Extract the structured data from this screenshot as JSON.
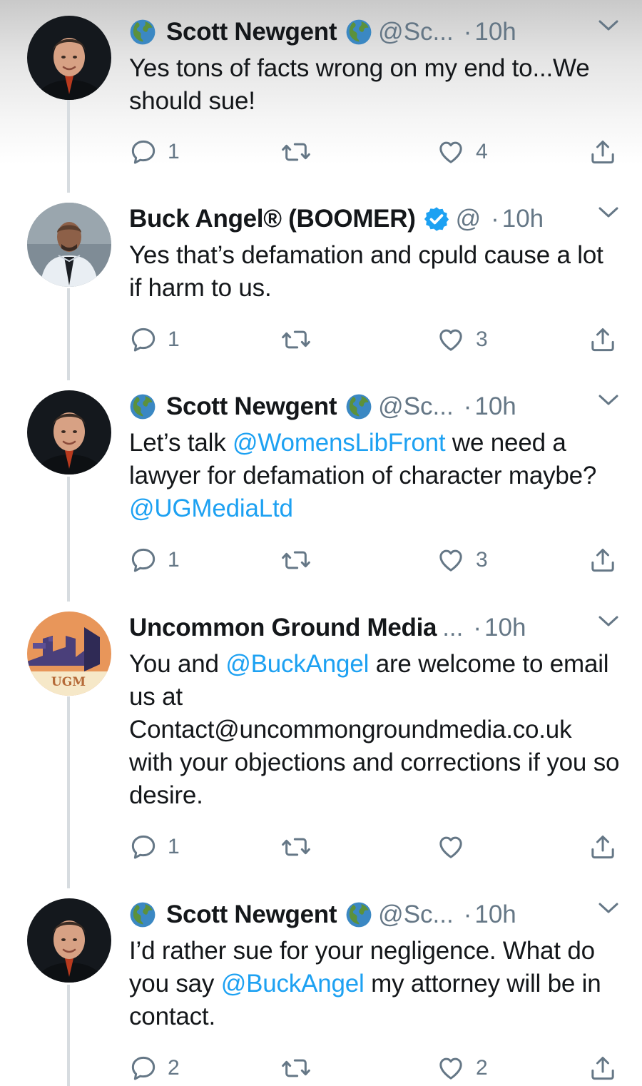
{
  "theme": {
    "mention_color": "#1da1f2",
    "verified_color": "#1da1f2",
    "muted_color": "#657786",
    "text_color": "#14171a",
    "thread_line_color": "#d7dce0"
  },
  "tweets": [
    {
      "author": {
        "name": "Scott Newgent",
        "handle": "@Sc...",
        "avatar": "man-portrait-dark",
        "emoji_before": "earth-globe-emoji",
        "emoji_after": "earth-globe-emoji"
      },
      "separator": "·",
      "time": "10h",
      "body": [
        {
          "text": "Yes tons of facts wrong on my end to...We should sue!"
        }
      ],
      "stats": {
        "replies": "1",
        "retweets": "",
        "likes": "4"
      }
    },
    {
      "author": {
        "name": "Buck Angel® (BOOMER)",
        "handle": "@",
        "avatar": "man-portrait-suit",
        "verified": true
      },
      "separator": "·",
      "time": "10h",
      "body": [
        {
          "text": "Yes that’s defamation and cpuld cause a lot if harm to us."
        }
      ],
      "stats": {
        "replies": "1",
        "retweets": "",
        "likes": "3"
      }
    },
    {
      "author": {
        "name": "Scott Newgent",
        "handle": "@Sc...",
        "avatar": "man-portrait-dark",
        "emoji_before": "earth-globe-emoji",
        "emoji_after": "earth-globe-emoji"
      },
      "separator": "·",
      "time": "10h",
      "body": [
        {
          "text": "Let’s talk "
        },
        {
          "text": "@WomensLibFront",
          "mention": true
        },
        {
          "text": " we need a lawyer for defamation of character maybe? "
        },
        {
          "text": "@UGMediaLtd",
          "mention": true
        }
      ],
      "stats": {
        "replies": "1",
        "retweets": "",
        "likes": "3"
      }
    },
    {
      "author": {
        "name": "Uncommon Ground Media",
        "handle": "...",
        "avatar": "ugm-logo",
        "logo_text": "UGM"
      },
      "separator": "·",
      "time": "10h",
      "body": [
        {
          "text": "You and "
        },
        {
          "text": "@BuckAngel",
          "mention": true
        },
        {
          "text": " are welcome to email us at Contact@uncommongroundmedia.co.uk with your objections and corrections if you so desire."
        }
      ],
      "stats": {
        "replies": "1",
        "retweets": "",
        "likes": ""
      }
    },
    {
      "author": {
        "name": "Scott Newgent",
        "handle": "@Sc...",
        "avatar": "man-portrait-dark",
        "emoji_before": "earth-globe-emoji",
        "emoji_after": "earth-globe-emoji"
      },
      "separator": "·",
      "time": "10h",
      "body": [
        {
          "text": "I’d rather sue for your negligence. What do you say "
        },
        {
          "text": "@BuckAngel",
          "mention": true
        },
        {
          "text": " my attorney will be in contact."
        }
      ],
      "stats": {
        "replies": "2",
        "retweets": "",
        "likes": "2"
      }
    }
  ]
}
